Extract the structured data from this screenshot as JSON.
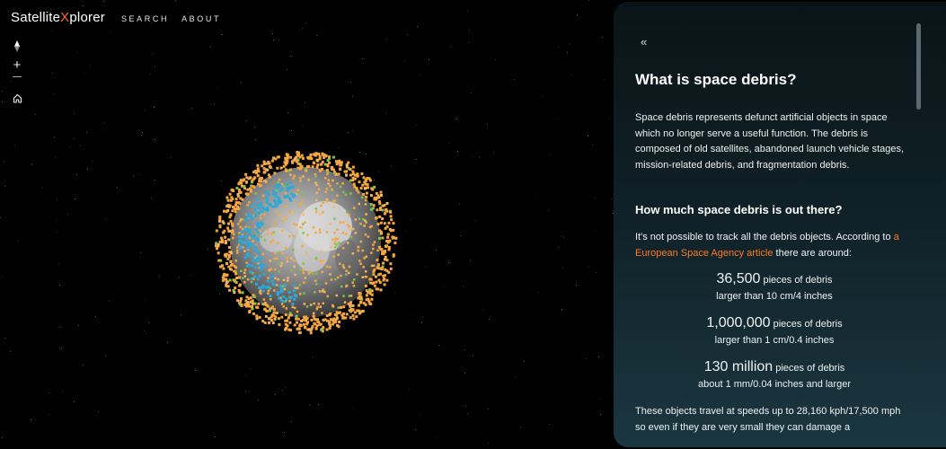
{
  "app": {
    "logo_prefix": "Satellite",
    "logo_x": "X",
    "logo_suffix": "plorer",
    "accent_color": "#ff6a1a"
  },
  "nav": {
    "search": "SEARCH",
    "about": "ABOUT"
  },
  "map_tools": {
    "compass_icon": "compass-needle-icon",
    "zoom_in": "+",
    "zoom_out": "—",
    "home_icon": "home-icon"
  },
  "globe": {
    "debris_colors": [
      "#f5a742",
      "#f7b562",
      "#7ec34b",
      "#29a9dc"
    ]
  },
  "panel": {
    "collapse_glyph": "«",
    "title": "What is space debris?",
    "intro": "Space debris represents defunct artificial objects in space which no longer serve a useful function. The debris is composed of old satellites, abandoned launch vehicle stages, mission-related debris, and fragmentation debris.",
    "subtitle": "How much space debris is out there?",
    "track_before": "It's not possible to track all the debris objects. According to ",
    "track_link": "a European Space Agency article",
    "track_after": " there are around:",
    "stats": [
      {
        "count": "36,500",
        "unit": " pieces of debris",
        "desc": "larger than 10 cm/4 inches"
      },
      {
        "count": "1,000,000",
        "unit": " pieces of debris",
        "desc": "larger than 1 cm/0.4 inches"
      },
      {
        "count": "130 million",
        "unit": " pieces of debris",
        "desc": "about 1 mm/0.04 inches and larger"
      }
    ],
    "speed_text": "These objects travel at speeds up to 28,160 kph/17,500 mph so even if they are very small they can damage a"
  }
}
